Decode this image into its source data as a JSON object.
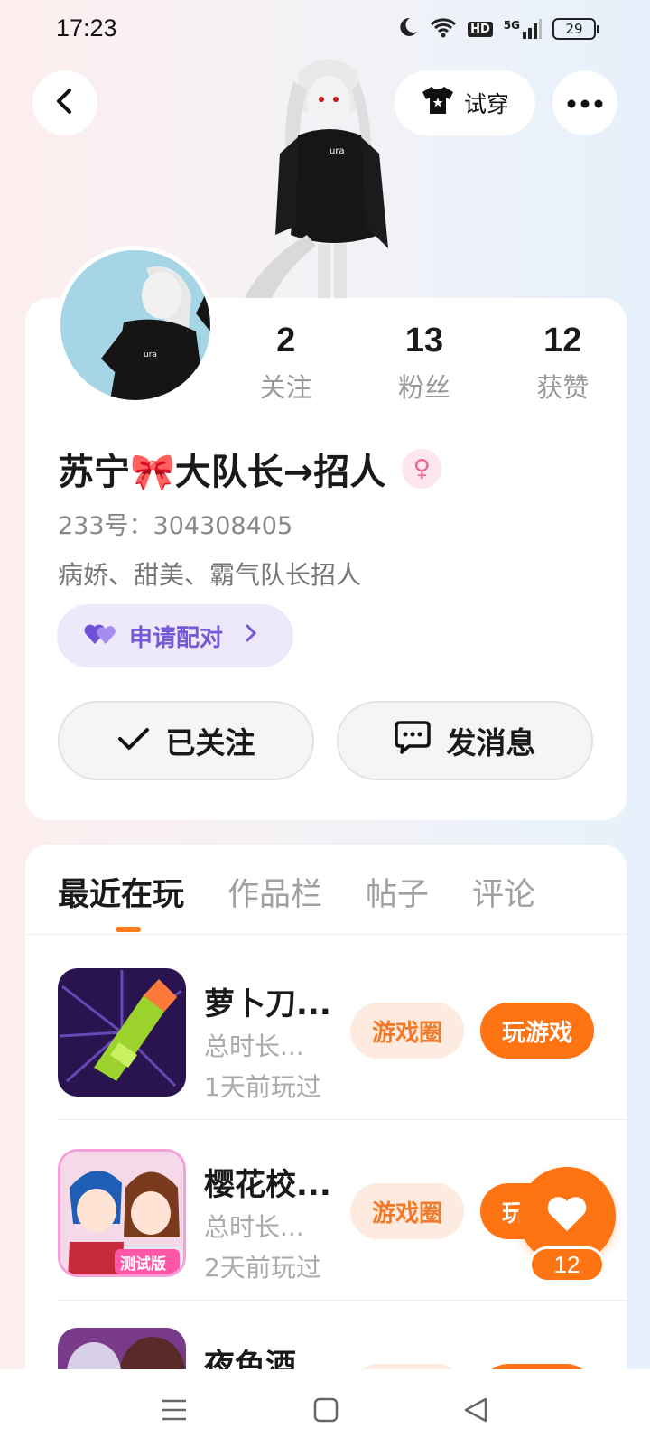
{
  "status_bar": {
    "time": "17:23",
    "network": "5G",
    "hd": "HD",
    "battery": "29"
  },
  "top_nav": {
    "tryon_label": "试穿"
  },
  "profile": {
    "stats": [
      {
        "value": "2",
        "label": "关注"
      },
      {
        "value": "13",
        "label": "粉丝"
      },
      {
        "value": "12",
        "label": "获赞"
      }
    ],
    "name": "苏宁🎀大队长→招人",
    "gender_symbol": "♀",
    "uid": "233号：304308405",
    "bio": "病娇、甜美、霸气队长招人",
    "pair_label": "申请配对",
    "follow_label": "已关注",
    "message_label": "发消息"
  },
  "tabs": [
    "最近在玩",
    "作品栏",
    "帖子",
    "评论"
  ],
  "games": [
    {
      "name": "萝卜刀...",
      "duration": "总时长...",
      "last_played": "1天前玩过",
      "circle_label": "游戏圈",
      "play_label": "玩游戏"
    },
    {
      "name": "樱花校...",
      "duration": "总时长...",
      "last_played": "2天前玩过",
      "circle_label": "游戏圈",
      "play_label": "玩游戏",
      "icon_badge": "测试版"
    },
    {
      "name": "夜色酒...",
      "duration": "",
      "last_played": "",
      "circle_label": "",
      "play_label": ""
    }
  ],
  "like": {
    "count": "12"
  },
  "colors": {
    "accent": "#ff7412",
    "pair_purple": "#7459d6",
    "muted": "#999999"
  }
}
